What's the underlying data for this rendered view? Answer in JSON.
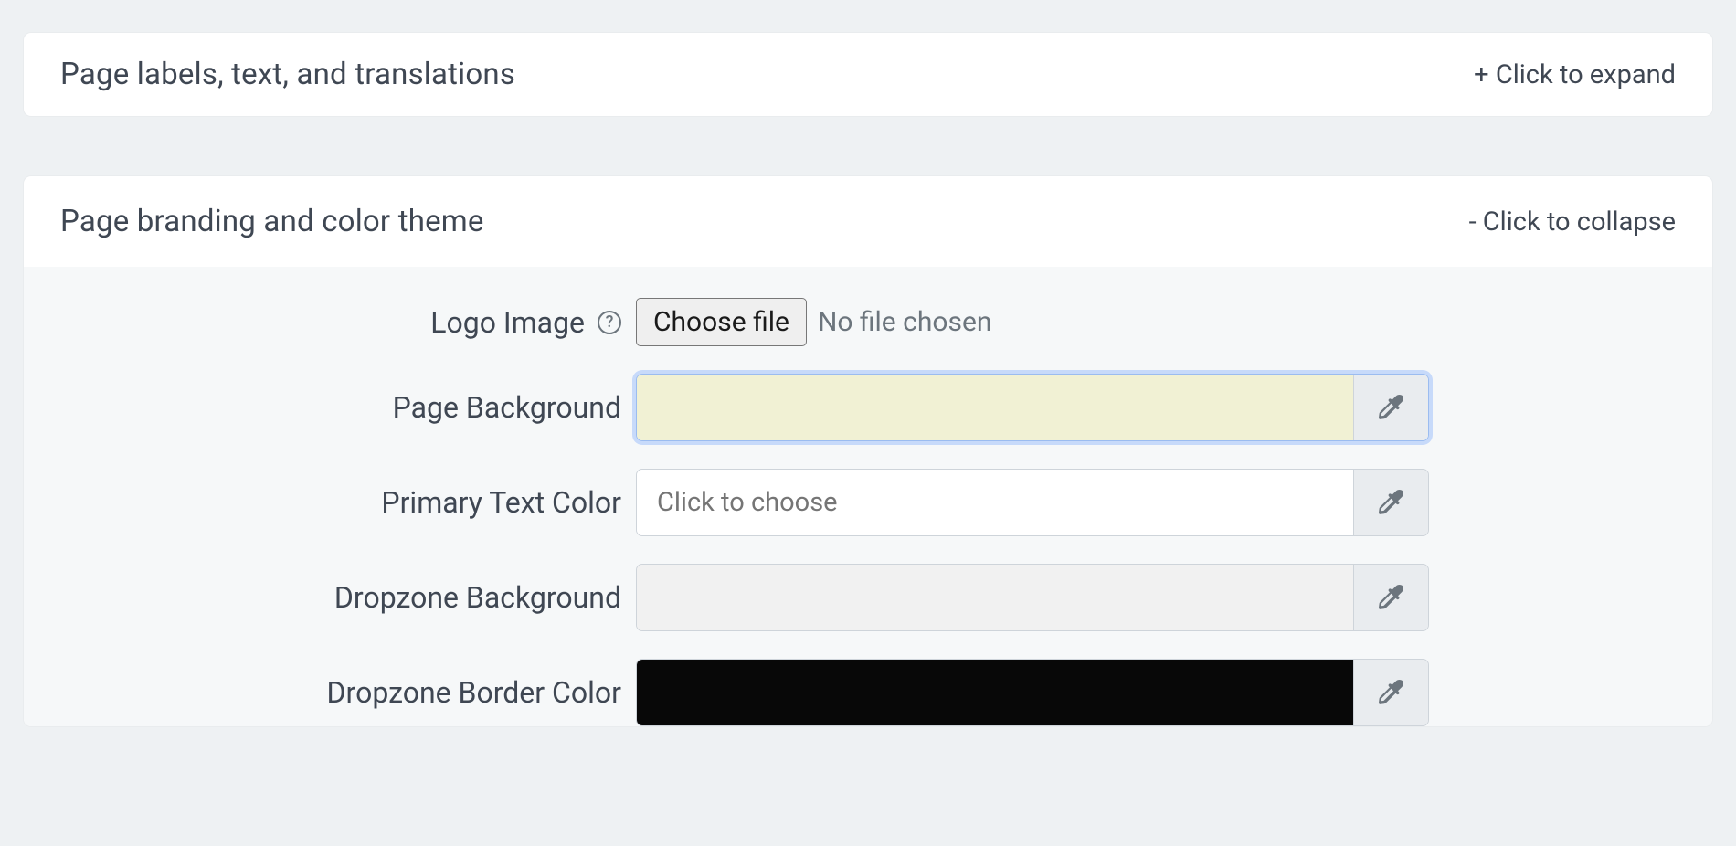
{
  "panels": {
    "labels": {
      "title": "Page labels, text, and translations",
      "toggle": "+ Click to expand"
    },
    "branding": {
      "title": "Page branding and color theme",
      "toggle": "- Click to collapse"
    }
  },
  "form": {
    "logo": {
      "label": "Logo Image",
      "button": "Choose file",
      "status": "No file chosen",
      "help_tooltip": "?"
    },
    "page_background": {
      "label": "Page Background",
      "placeholder": "",
      "color": "#f1f1d4"
    },
    "primary_text": {
      "label": "Primary Text Color",
      "placeholder": "Click to choose",
      "color": "#ffffff"
    },
    "dropzone_bg": {
      "label": "Dropzone Background",
      "placeholder": "",
      "color": "#f1f1f1"
    },
    "dropzone_border": {
      "label": "Dropzone Border Color",
      "placeholder": "",
      "color": "#080808"
    }
  },
  "icons": {
    "eyedropper": "eyedropper-icon",
    "help": "help-icon"
  }
}
